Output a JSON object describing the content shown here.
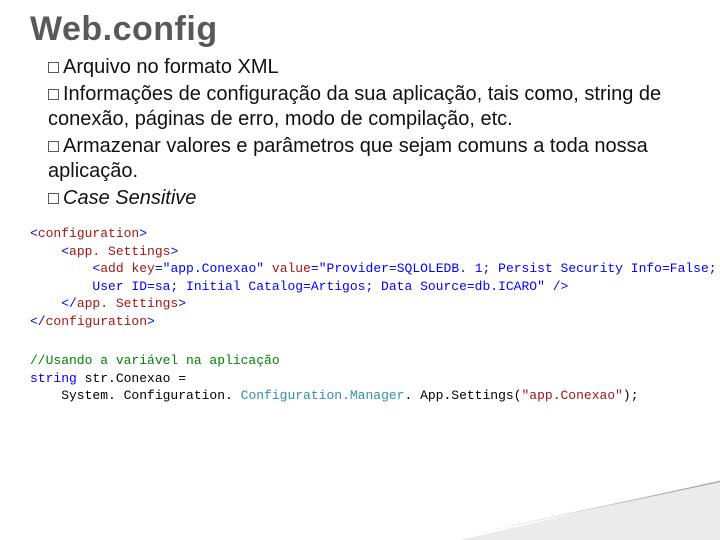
{
  "title": "Web.config",
  "bullets": [
    {
      "lead": "Arquivo",
      "rest": " no formato XML"
    },
    {
      "lead": "Informações",
      "rest": " de configuração da sua aplicação, tais como, string de conexão, páginas de erro, modo de compilação, etc."
    },
    {
      "lead": "Armazenar",
      "rest": " valores e parâmetros que sejam comuns a toda nossa aplicação."
    },
    {
      "lead": "Case",
      "rest": " Sensitive",
      "italic": true
    }
  ],
  "code": {
    "l1a": "<",
    "l1b": "configuration",
    "l1c": ">",
    "l2a": "    <",
    "l2b": "app. Settings",
    "l2c": ">",
    "l3a": "        <",
    "l3b": "add",
    "l3sp": " ",
    "l3k": "key",
    "l3e1": "=",
    "l3kv": "\"app.Conexao\"",
    "l3sp2": " ",
    "l3v": "value",
    "l3e2": "=",
    "l3vv": "\"Provider=SQLOLEDB. 1; Persist Security Info=False;",
    "l4": "        User ID=sa; Initial Catalog=Artigos; Data Source=db.ICARO\"",
    "l4end": " />",
    "l5a": "    </",
    "l5b": "app. Settings",
    "l5c": ">",
    "l6a": "</",
    "l6b": "configuration",
    "l6c": ">"
  },
  "code2": {
    "c1": "//Usando a variável na aplicação",
    "c2a": "string",
    "c2b": " str.Conexao =",
    "c3a": "    System. Configuration. ",
    "c3b": "Configuration.Manager",
    "c3c": ". App.Settings(",
    "c3d": "\"app.Conexao\"",
    "c3e": ");"
  }
}
